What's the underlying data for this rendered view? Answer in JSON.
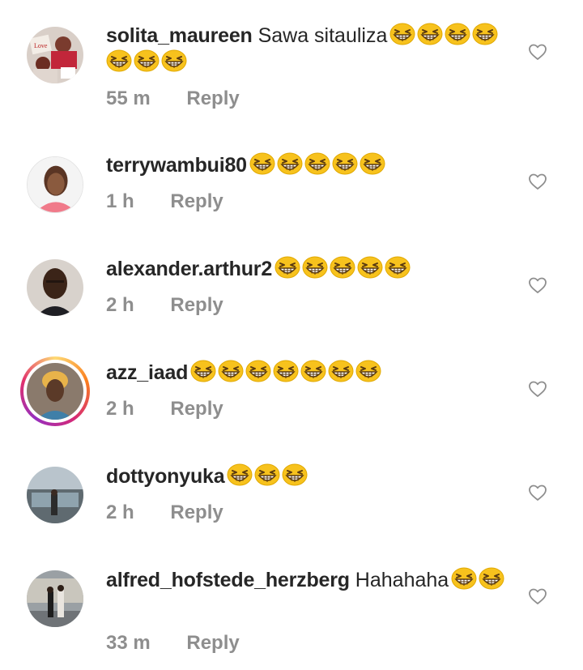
{
  "comments": [
    {
      "username": "solita_maureen",
      "text": "Sawa sitauliza",
      "emoji_count": 7,
      "time": "55 m",
      "reply": "Reply"
    },
    {
      "username": "terrywambui80",
      "text": "",
      "emoji_count": 5,
      "time": "1 h",
      "reply": "Reply"
    },
    {
      "username": "alexander.arthur2",
      "text": "",
      "emoji_count": 5,
      "time": "2 h",
      "reply": "Reply"
    },
    {
      "username": "azz_iaad",
      "text": "",
      "emoji_count": 7,
      "time": "2 h",
      "reply": "Reply"
    },
    {
      "username": "dottyonyuka",
      "text": "",
      "emoji_count": 3,
      "time": "2 h",
      "reply": "Reply"
    },
    {
      "username": "alfred_hofstede_herzberg",
      "text": "Hahahaha",
      "emoji_count": 2,
      "time": "33 m",
      "reply": "Reply"
    }
  ],
  "icons": {
    "like": "heart-outline-icon",
    "emoji": "grinning-squinting-face-emoji"
  },
  "colors": {
    "meta": "#8e8e8e",
    "text": "#262626",
    "emoji": "#f7c21d"
  }
}
